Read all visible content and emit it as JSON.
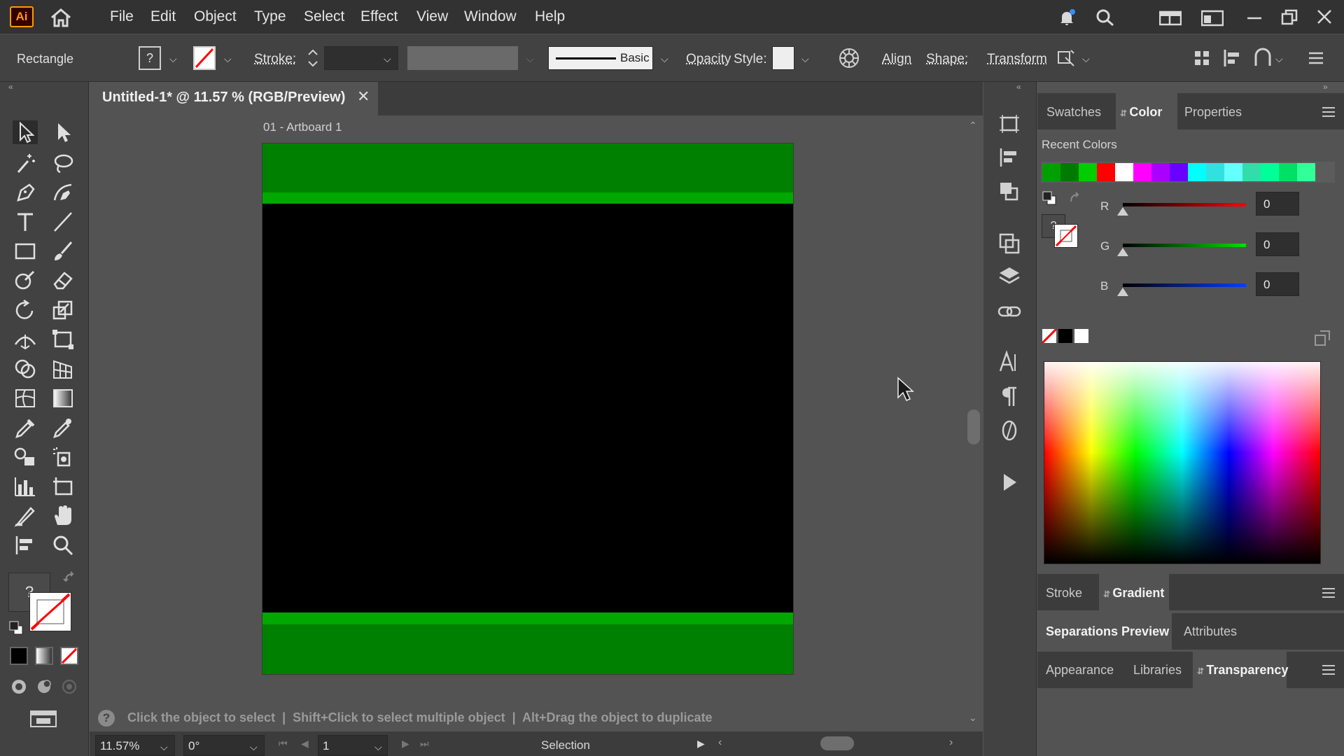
{
  "app": {
    "logo_text": "Ai"
  },
  "menu": [
    "File",
    "Edit",
    "Object",
    "Type",
    "Select",
    "Effect",
    "View",
    "Window",
    "Help"
  ],
  "control_bar": {
    "selection_label": "Rectangle",
    "fill_box_text": "?",
    "stroke_label": "Stroke:",
    "stroke_profile_label": "Basic",
    "opacity_label": "Opacity",
    "style_label": "Style:",
    "align_label": "Align",
    "shape_label": "Shape:",
    "transform_label": "Transform"
  },
  "document": {
    "tab_title": "Untitled-1* @ 11.57 % (RGB/Preview)",
    "close_glyph": "✕",
    "artboard_label": "01 - Artboard 1",
    "colors": {
      "band_dark": "#008000",
      "band_light": "#00a800",
      "background": "#000000"
    }
  },
  "status": {
    "hint_icon_text": "?",
    "hint_text": "Click the object to select  |  Shift+Click to select multiple object  |  Alt+Drag the object to duplicate",
    "zoom": "11.57%",
    "rotation": "0°",
    "artboard_number": "1",
    "tool_name": "Selection"
  },
  "toolbar": {
    "fill_stroke_text": "?"
  },
  "panels": {
    "top_tabs": [
      "Swatches",
      "Color",
      "Properties"
    ],
    "recent_colors_label": "Recent Colors",
    "recent_colors": [
      "#00a000",
      "#007a00",
      "#00cc00",
      "#ff0000",
      "#ffffff",
      "#ff00ff",
      "#aa00ff",
      "#6a00ff",
      "#00ffff",
      "#33e0e0",
      "#66ffff",
      "#33ddaa",
      "#00ff99",
      "#00e066",
      "#33ff99"
    ],
    "color_unknown_text": "?",
    "sliders": [
      {
        "label": "R",
        "value": "0",
        "color": "#ff0000"
      },
      {
        "label": "G",
        "value": "0",
        "color": "#00e000"
      },
      {
        "label": "B",
        "value": "0",
        "color": "#0040ff"
      }
    ],
    "second_tabs": [
      "Stroke",
      "Gradient"
    ],
    "third_tabs": [
      "Separations Preview",
      "Attributes"
    ],
    "fourth_tabs": [
      "Appearance",
      "Libraries",
      "Transparency"
    ]
  }
}
